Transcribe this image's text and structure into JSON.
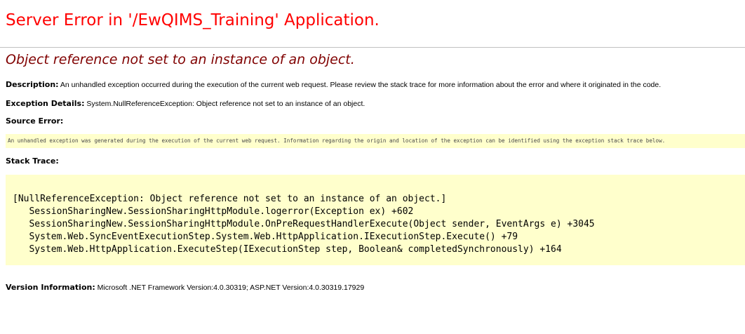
{
  "page": {
    "title": "Server Error in '/EwQIMS_Training' Application.",
    "subtitle": "Object reference not set to an instance of an object."
  },
  "description": {
    "label": "Description:",
    "text": " An unhandled exception occurred during the execution of the current web request. Please review the stack trace for more information about the error and where it originated in the code."
  },
  "exception_details": {
    "label": "Exception Details:",
    "text": " System.NullReferenceException: Object reference not set to an instance of an object."
  },
  "source_error": {
    "label": "Source Error:",
    "text": "An unhandled exception was generated during the execution of the current web request. Information regarding the origin and location of the exception can be identified using the exception stack trace below."
  },
  "stack_trace": {
    "label": "Stack Trace:",
    "lines": [
      "[NullReferenceException: Object reference not set to an instance of an object.]",
      "   SessionSharingNew.SessionSharingHttpModule.logerror(Exception ex) +602",
      "   SessionSharingNew.SessionSharingHttpModule.OnPreRequestHandlerExecute(Object sender, EventArgs e) +3045",
      "   System.Web.SyncEventExecutionStep.System.Web.HttpApplication.IExecutionStep.Execute() +79",
      "   System.Web.HttpApplication.ExecuteStep(IExecutionStep step, Boolean& completedSynchronously) +164"
    ]
  },
  "version_info": {
    "label": "Version Information:",
    "text": " Microsoft .NET Framework Version:4.0.30319; ASP.NET Version:4.0.30319.17929"
  },
  "colors": {
    "title": "#ff0000",
    "subtitle": "#800000",
    "code_background": "#ffffcc"
  }
}
